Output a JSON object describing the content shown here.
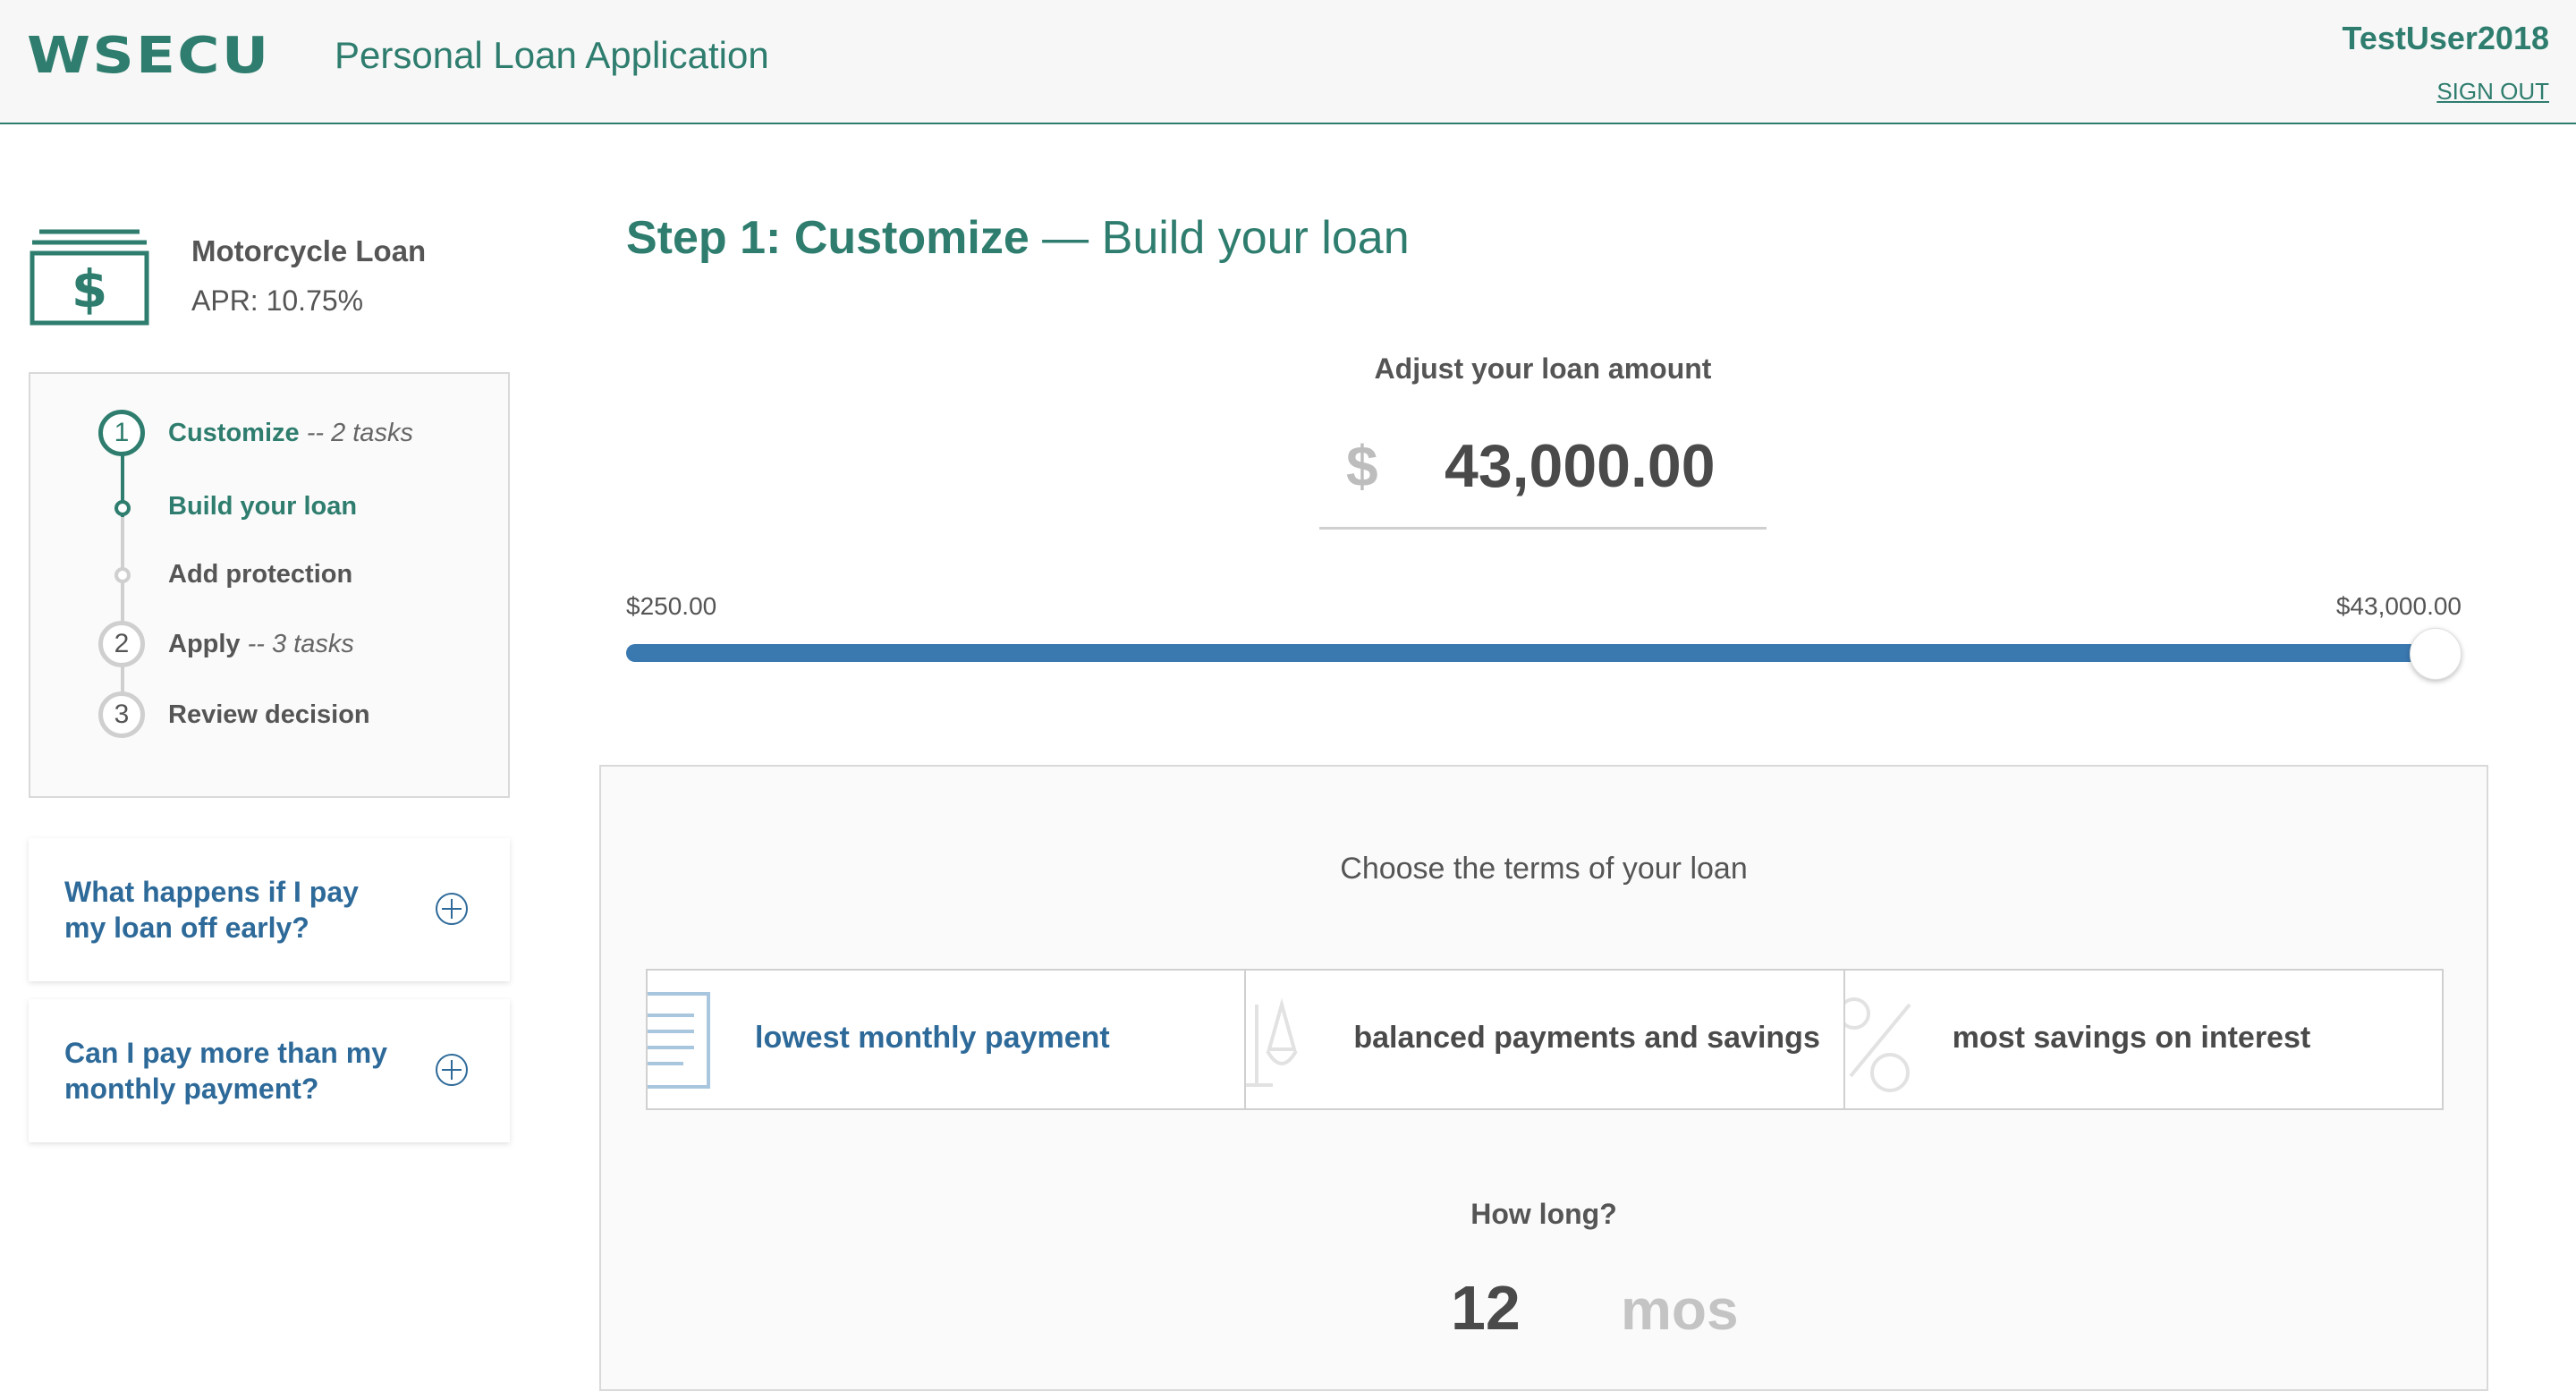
{
  "header": {
    "logo": "WSECU",
    "app_title": "Personal Loan Application",
    "username": "TestUser2018",
    "sign_out": "SIGN OUT"
  },
  "loan": {
    "icon": "cash-register-icon",
    "name": "Motorcycle Loan",
    "apr": "APR: 10.75%"
  },
  "steps": [
    {
      "number": "1",
      "label": "Customize",
      "note": " -- 2 tasks",
      "active": true,
      "substeps": [
        {
          "label": "Build your loan",
          "active": true
        },
        {
          "label": "Add protection",
          "active": false
        }
      ]
    },
    {
      "number": "2",
      "label": "Apply",
      "note": " -- 3 tasks",
      "active": false
    },
    {
      "number": "3",
      "label": "Review decision",
      "note": "",
      "active": false
    }
  ],
  "faqs": [
    {
      "question": "What happens if I pay my loan off early?",
      "icon": "plus-circle-icon"
    },
    {
      "question": "Can I pay more than my monthly payment?",
      "icon": "plus-circle-icon"
    }
  ],
  "main": {
    "title_bold": "Step 1: Customize",
    "title_rest": " — Build your loan",
    "amount_label": "Adjust your loan amount",
    "currency": "$",
    "amount_value": "43,000.00",
    "slider": {
      "min_label": "$250.00",
      "max_label": "$43,000.00",
      "min": 250,
      "max": 43000,
      "value": 43000
    }
  },
  "terms": {
    "heading": "Choose the terms of your loan",
    "options": [
      {
        "label": "lowest monthly payment",
        "icon": "document-icon",
        "selected": true
      },
      {
        "label": "balanced payments and savings",
        "icon": "scale-icon",
        "selected": false
      },
      {
        "label": "most savings on interest",
        "icon": "percent-icon",
        "selected": false
      }
    ],
    "how_long_label": "How long?",
    "term_value": "12",
    "term_unit": "mos"
  },
  "colors": {
    "brand": "#2e7d6e",
    "link": "#2e6a99",
    "slider": "#3a78b0"
  }
}
